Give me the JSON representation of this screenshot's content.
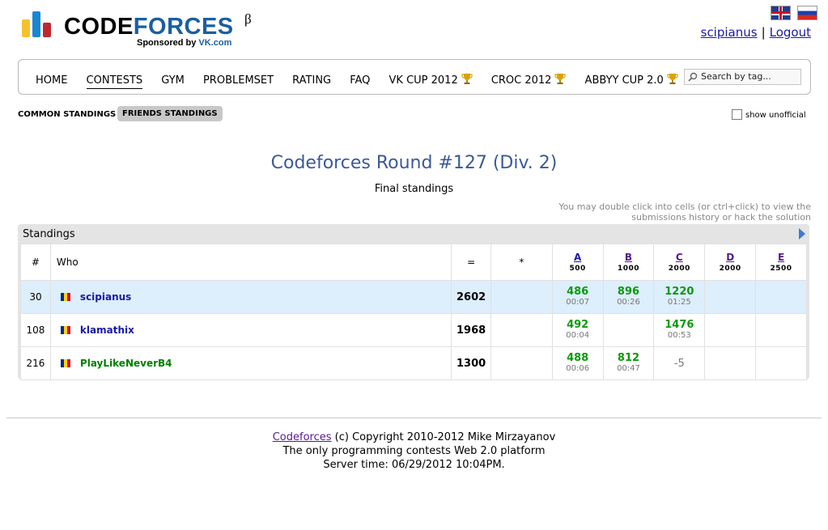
{
  "header": {
    "logo_code": "CODE",
    "logo_forces": "FORCES",
    "logo_beta": "β",
    "sponsor_prefix": "Sponsored by ",
    "sponsor_name": "VK.com",
    "username": "scipianus",
    "separator": "|",
    "logout": "Logout"
  },
  "menu": {
    "items": [
      "HOME",
      "CONTESTS",
      "GYM",
      "PROBLEMSET",
      "RATING",
      "FAQ",
      "VK CUP 2012",
      "CROC 2012",
      "ABBYY CUP 2.0"
    ],
    "active": "CONTESTS",
    "search_placeholder": "Search by tag..."
  },
  "standings_tabs": {
    "common": "COMMON STANDINGS",
    "friends": "FRIENDS STANDINGS",
    "show_unofficial": "show unofficial"
  },
  "contest": {
    "title": "Codeforces Round #127 (Div. 2)",
    "subtitle": "Final standings",
    "hint_line1": "You may double click into cells (or ctrl+click) to view the",
    "hint_line2": "submissions history or hack the solution"
  },
  "standings": {
    "box_title": "Standings",
    "headers": {
      "rank": "#",
      "who": "Who",
      "score": "=",
      "hacks": "*"
    },
    "problems": [
      {
        "letter": "A",
        "points": "500"
      },
      {
        "letter": "B",
        "points": "1000"
      },
      {
        "letter": "C",
        "points": "2000"
      },
      {
        "letter": "D",
        "points": "2000"
      },
      {
        "letter": "E",
        "points": "2500"
      }
    ],
    "rows": [
      {
        "rank": "30",
        "handle": "scipianus",
        "score": "2602",
        "hacks": "",
        "A": {
          "pts": "486",
          "time": "00:07"
        },
        "B": {
          "pts": "896",
          "time": "00:26"
        },
        "C": {
          "pts": "1220",
          "time": "01:25"
        }
      },
      {
        "rank": "108",
        "handle": "klamathix",
        "score": "1968",
        "hacks": "",
        "A": {
          "pts": "492",
          "time": "00:04"
        },
        "C": {
          "pts": "1476",
          "time": "00:53"
        }
      },
      {
        "rank": "216",
        "handle": "PlayLikeNeverB4",
        "score": "1300",
        "hacks": "",
        "A": {
          "pts": "488",
          "time": "00:06"
        },
        "B": {
          "pts": "812",
          "time": "00:47"
        },
        "C": {
          "rejected": "-5"
        }
      }
    ]
  },
  "footer": {
    "link": "Codeforces",
    "copyright": " (c) Copyright 2010-2012 Mike Mirzayanov",
    "tagline": "The only programming contests Web 2.0 platform",
    "server_time": "Server time: 06/29/2012 10:04PM."
  }
}
